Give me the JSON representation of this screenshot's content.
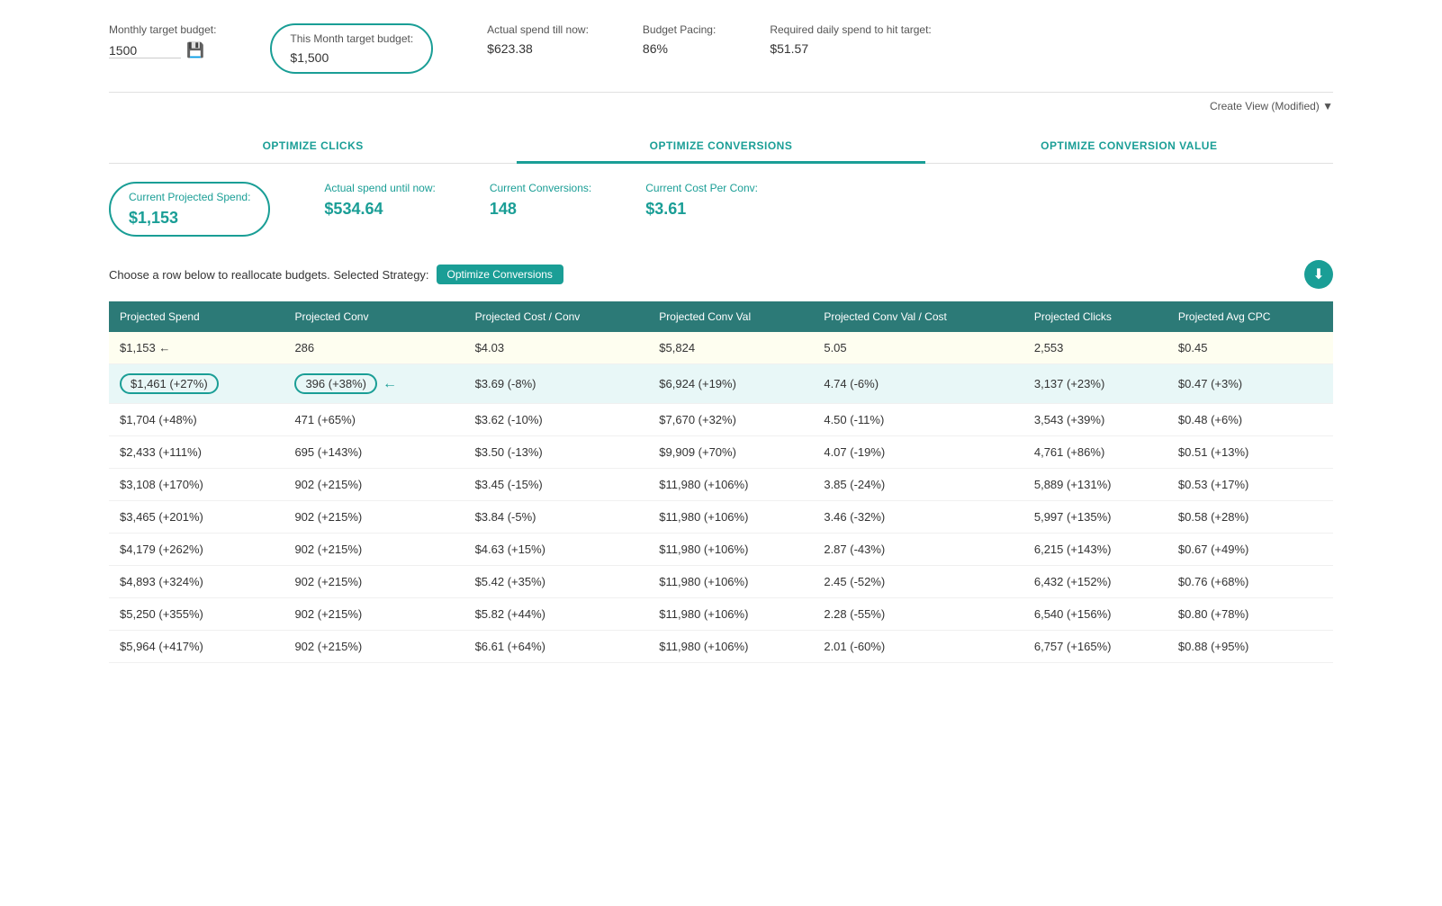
{
  "budget": {
    "monthly_target_label": "Monthly target budget:",
    "monthly_target_value": "1500",
    "this_month_label": "This Month target budget:",
    "this_month_value": "$1,500",
    "actual_spend_label": "Actual spend till now:",
    "actual_spend_value": "$623.38",
    "pacing_label": "Budget Pacing:",
    "pacing_value": "86%",
    "required_daily_label": "Required daily spend to hit target:",
    "required_daily_value": "$51.57"
  },
  "create_view": {
    "label": "Create View (Modified) ▼"
  },
  "tabs": [
    {
      "id": "clicks",
      "label": "OPTIMIZE CLICKS",
      "active": false
    },
    {
      "id": "conversions",
      "label": "OPTIMIZE CONVERSIONS",
      "active": true
    },
    {
      "id": "conversion_value",
      "label": "OPTIMIZE CONVERSION VALUE",
      "active": false
    }
  ],
  "stats": {
    "projected_spend_label": "Current Projected Spend:",
    "projected_spend_value": "$1,153",
    "actual_spend_label": "Actual spend until now:",
    "actual_spend_value": "$534.64",
    "conversions_label": "Current Conversions:",
    "conversions_value": "148",
    "cost_per_conv_label": "Current Cost Per Conv:",
    "cost_per_conv_value": "$3.61"
  },
  "strategy_row": {
    "text": "Choose a row below to reallocate budgets. Selected Strategy:",
    "badge": "Optimize Conversions"
  },
  "table": {
    "headers": [
      "Projected Spend",
      "Projected Conv",
      "Projected Cost / Conv",
      "Projected Conv Val",
      "Projected Conv Val / Cost",
      "Projected Clicks",
      "Projected Avg CPC"
    ],
    "rows": [
      {
        "type": "baseline",
        "cells": [
          "$1,153 ←",
          "286",
          "$4.03",
          "$5,824",
          "5.05",
          "2,553",
          "$0.45"
        ],
        "changes": [
          "",
          "",
          "",
          "",
          "",
          "",
          ""
        ],
        "arrow": true
      },
      {
        "type": "selected",
        "cells": [
          "$1,461 (+27%)",
          "396 (+38%)",
          "$3.69 (-8%)",
          "$6,924 (+19%)",
          "4.74 (-6%)",
          "3,137 (+23%)",
          "$0.47 (+3%)"
        ],
        "circled": [
          0,
          1
        ],
        "leftarrow": true
      },
      {
        "type": "normal",
        "cells": [
          "$1,704 (+48%)",
          "471 (+65%)",
          "$3.62 (-10%)",
          "$7,670 (+32%)",
          "4.50 (-11%)",
          "3,543 (+39%)",
          "$0.48 (+6%)"
        ]
      },
      {
        "type": "normal",
        "cells": [
          "$2,433 (+111%)",
          "695 (+143%)",
          "$3.50 (-13%)",
          "$9,909 (+70%)",
          "4.07 (-19%)",
          "4,761 (+86%)",
          "$0.51 (+13%)"
        ]
      },
      {
        "type": "normal",
        "cells": [
          "$3,108 (+170%)",
          "902 (+215%)",
          "$3.45 (-15%)",
          "$11,980 (+106%)",
          "3.85 (-24%)",
          "5,889 (+131%)",
          "$0.53 (+17%)"
        ]
      },
      {
        "type": "normal",
        "cells": [
          "$3,465 (+201%)",
          "902 (+215%)",
          "$3.84 (-5%)",
          "$11,980 (+106%)",
          "3.46 (-32%)",
          "5,997 (+135%)",
          "$0.58 (+28%)"
        ]
      },
      {
        "type": "normal",
        "cells": [
          "$4,179 (+262%)",
          "902 (+215%)",
          "$4.63 (+15%)",
          "$11,980 (+106%)",
          "2.87 (-43%)",
          "6,215 (+143%)",
          "$0.67 (+49%)"
        ]
      },
      {
        "type": "normal",
        "cells": [
          "$4,893 (+324%)",
          "902 (+215%)",
          "$5.42 (+35%)",
          "$11,980 (+106%)",
          "2.45 (-52%)",
          "6,432 (+152%)",
          "$0.76 (+68%)"
        ]
      },
      {
        "type": "normal",
        "cells": [
          "$5,250 (+355%)",
          "902 (+215%)",
          "$5.82 (+44%)",
          "$11,980 (+106%)",
          "2.28 (-55%)",
          "6,540 (+156%)",
          "$0.80 (+78%)"
        ]
      },
      {
        "type": "normal",
        "cells": [
          "$5,964 (+417%)",
          "902 (+215%)",
          "$6.61 (+64%)",
          "$11,980 (+106%)",
          "2.01 (-60%)",
          "6,757 (+165%)",
          "$0.88 (+95%)"
        ]
      }
    ]
  }
}
